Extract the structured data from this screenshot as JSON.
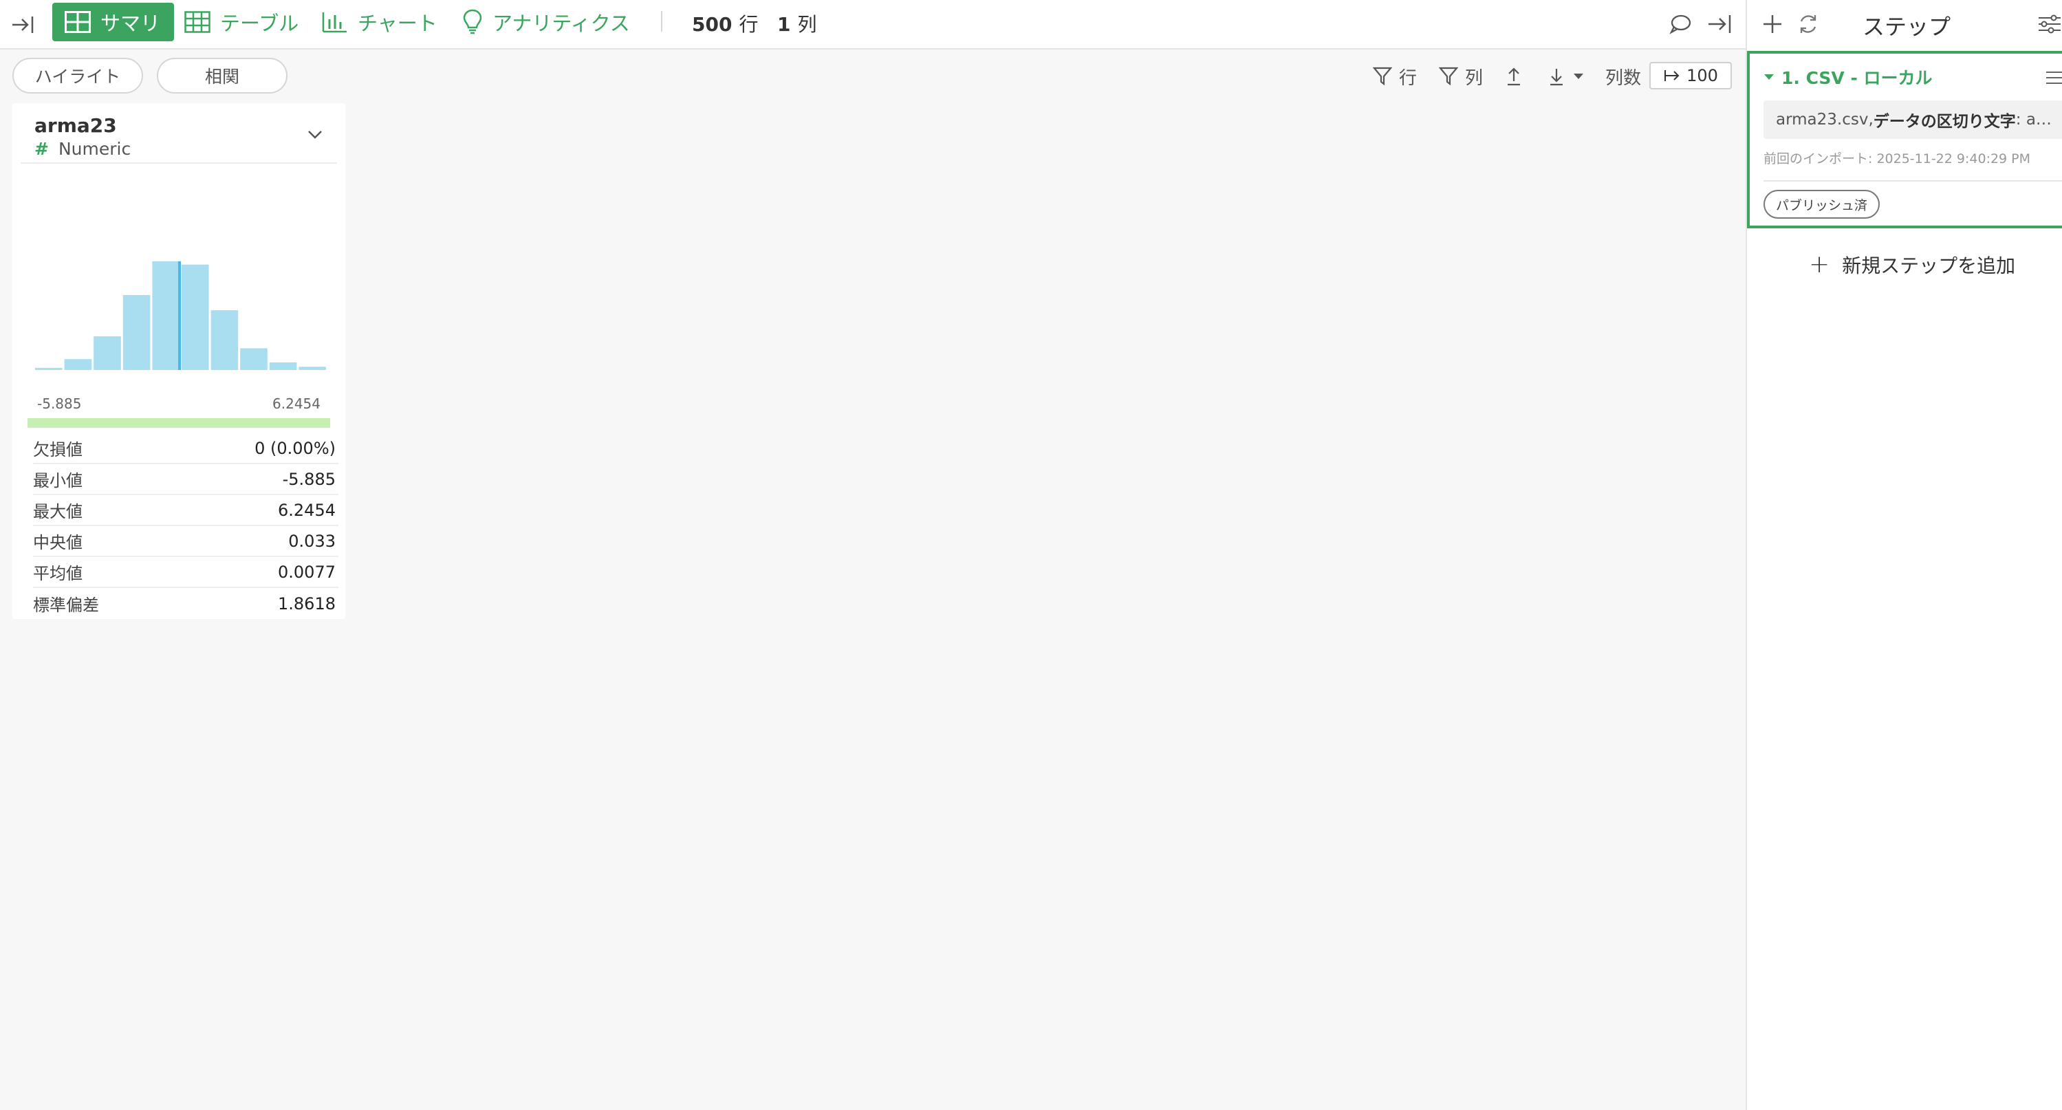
{
  "toolbar": {
    "tabs": [
      {
        "label": "サマリ",
        "active": true
      },
      {
        "label": "テーブル",
        "active": false
      },
      {
        "label": "チャート",
        "active": false
      },
      {
        "label": "アナリティクス",
        "active": false
      }
    ],
    "rows_count": "500",
    "rows_unit": "行",
    "cols_count": "1",
    "cols_unit": "列"
  },
  "subtoolbar": {
    "highlight_label": "ハイライト",
    "correlation_label": "相関",
    "filter_rows_label": "行",
    "filter_cols_label": "列",
    "column_count_label": "列数",
    "column_limit": "100"
  },
  "column_card": {
    "name": "arma23",
    "type": "Numeric",
    "range_min": "-5.885",
    "range_max": "6.2454",
    "histogram": {
      "type": "bar",
      "bins_relative_height": [
        0.02,
        0.1,
        0.31,
        0.69,
        1.0,
        0.97,
        0.55,
        0.2,
        0.07,
        0.03
      ]
    },
    "stats": [
      {
        "label": "欠損値",
        "value": "0 (0.00%)"
      },
      {
        "label": "最小値",
        "value": "-5.885"
      },
      {
        "label": "最大値",
        "value": "6.2454"
      },
      {
        "label": "中央値",
        "value": "0.033"
      },
      {
        "label": "平均値",
        "value": "0.0077"
      },
      {
        "label": "標準偏差",
        "value": "1.8618"
      }
    ]
  },
  "right_panel": {
    "title": "ステップ",
    "step": {
      "title": "1. CSV - ローカル",
      "desc_file": "arma23.csv, ",
      "desc_key": "データの区切り文字",
      "desc_rest": ": a…",
      "time": "前回のインポート: 2025-11-22 9:40:29 PM",
      "badge": "パブリッシュ済"
    },
    "add_step_label": "新規ステップを追加"
  },
  "colors": {
    "accent": "#3ba55f",
    "bar": "#a8def0",
    "bar_highlight": "#4bb8e2",
    "valid": "#c6f0b2"
  }
}
